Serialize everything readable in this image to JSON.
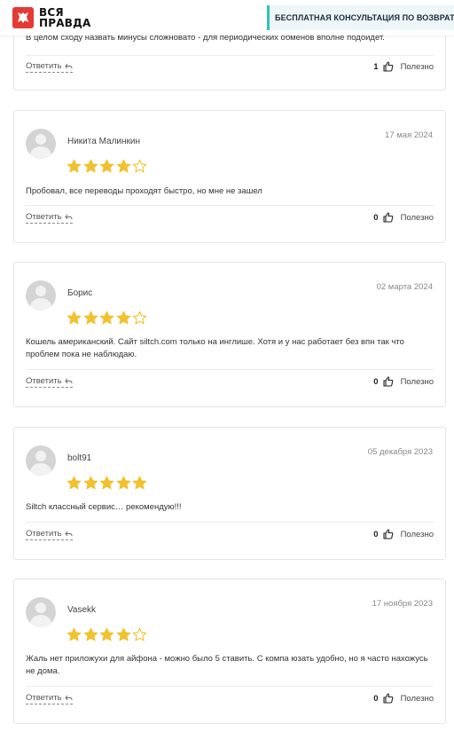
{
  "header": {
    "logo_line1": "ВСЯ",
    "logo_line2": "ПРАВДА",
    "consult_button": "БЕСПЛАТНАЯ КОНСУЛЬТАЦИЯ ПО ВОЗВРАТУ"
  },
  "colors": {
    "star": "#f2c12e",
    "accent": "#2ec4b6",
    "logo": "#e53935"
  },
  "partial_review": {
    "text": "В целом сходу назвать минусы сложновато - для периодических обменов вполне подойдет.",
    "reply_label": "Ответить",
    "likes": "1",
    "useful_label": "Полезно"
  },
  "reviews": [
    {
      "author": "Никита Малинкин",
      "date": "17 мая 2024",
      "rating": 4,
      "text": "Пробовал, все переводы проходят быстро, но мне не зашел",
      "reply_label": "Ответить",
      "likes": "0",
      "useful_label": "Полезно"
    },
    {
      "author": "Борис",
      "date": "02 марта 2024",
      "rating": 4,
      "text": "Кошель американский. Сайт siltch.com только на инглише. Хотя и у нас работает без впн так что проблем пока не наблюдаю.",
      "reply_label": "Ответить",
      "likes": "0",
      "useful_label": "Полезно"
    },
    {
      "author": "bolt91",
      "date": "05 декабря 2023",
      "rating": 5,
      "text": "Siltch классный сервис… рекомендую!!!",
      "reply_label": "Ответить",
      "likes": "0",
      "useful_label": "Полезно"
    },
    {
      "author": "Vasekk",
      "date": "17 ноября 2023",
      "rating": 4,
      "text": "Жаль нет приложухи для айфона - можно было 5 ставить. С компа юзать удобно, но я часто нахожусь не дома.",
      "reply_label": "Ответить",
      "likes": "0",
      "useful_label": "Полезно"
    }
  ]
}
